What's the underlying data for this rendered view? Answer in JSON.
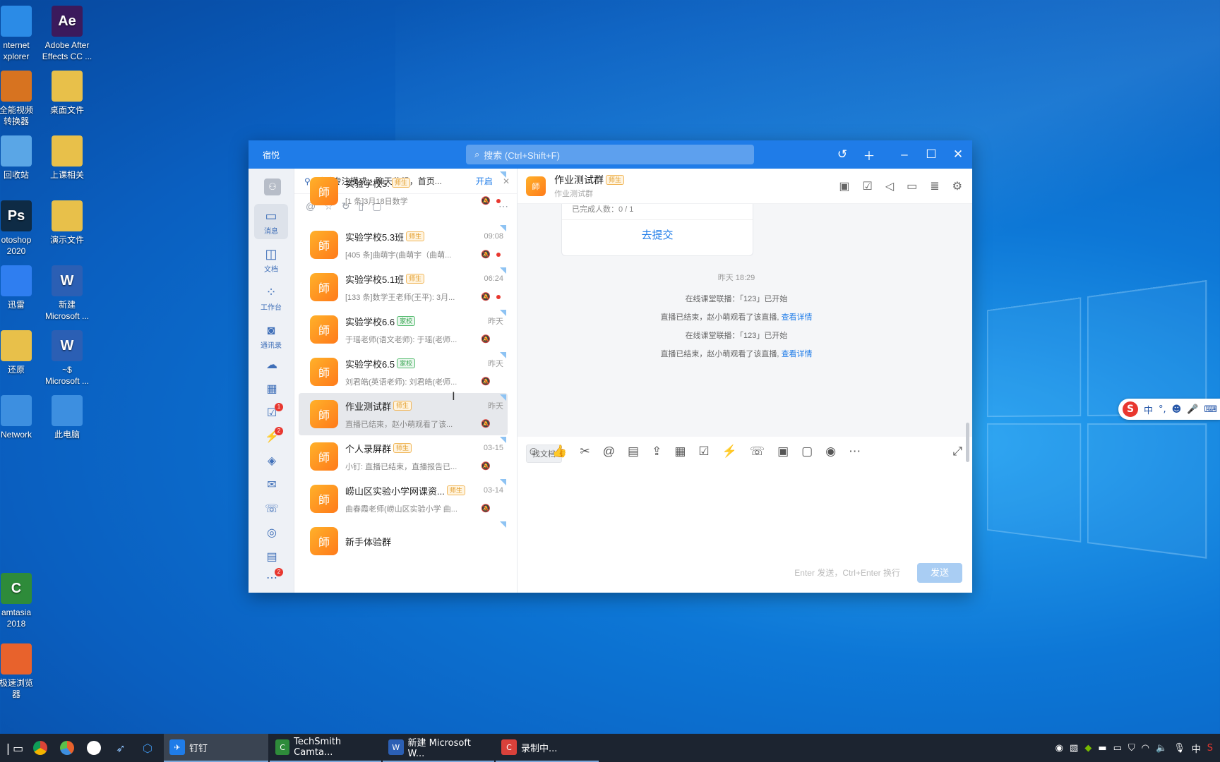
{
  "desktop": {
    "icons": [
      {
        "label1": "nternet",
        "label2": "xplorer",
        "icon": "ie-icon",
        "color": "#2b8be6"
      },
      {
        "label1": "Adobe After",
        "label2": "Effects CC ...",
        "icon": "after-effects-icon",
        "glyph": "Ae",
        "color": "#3b1a5c"
      },
      {
        "label1": "全能视频",
        "label2": "转换器",
        "icon": "video-converter-icon",
        "color": "#d77320"
      },
      {
        "label1": "桌面文件",
        "label2": "",
        "icon": "folder-icon",
        "color": "#e8c04a"
      },
      {
        "label1": "回收站",
        "label2": "",
        "icon": "recycle-bin-icon",
        "color": "#5aa6e6"
      },
      {
        "label1": "上课相关",
        "label2": "",
        "icon": "folder-icon",
        "color": "#e8c04a"
      },
      {
        "label1": "otoshop",
        "label2": "2020",
        "icon": "photoshop-icon",
        "glyph": "Ps",
        "color": "#0e2b45"
      },
      {
        "label1": "演示文件",
        "label2": "",
        "icon": "folder-icon",
        "color": "#e8c04a"
      },
      {
        "label1": "迅雷",
        "label2": "",
        "icon": "xunlei-icon",
        "color": "#2f7ef0"
      },
      {
        "label1": "新建",
        "label2": "Microsoft ...",
        "icon": "word-icon",
        "glyph": "W",
        "color": "#2b5fb4"
      },
      {
        "label1": "还原",
        "label2": "",
        "icon": "folder-icon",
        "color": "#e8c04a"
      },
      {
        "label1": "~$",
        "label2": "Microsoft ...",
        "icon": "word-icon",
        "glyph": "W",
        "color": "#2b5fb4"
      },
      {
        "label1": "Network",
        "label2": "",
        "icon": "network-icon",
        "color": "#3d8fe0"
      },
      {
        "label1": "此电脑",
        "label2": "",
        "icon": "computer-icon",
        "color": "#3d8fe0"
      },
      {
        "label1": "amtasia",
        "label2": "2018",
        "icon": "camtasia-icon",
        "glyph": "C",
        "color": "#2e8b3a"
      },
      {
        "label1": "极速浏览",
        "label2": "器",
        "icon": "browser-icon",
        "color": "#e8622c"
      }
    ]
  },
  "app": {
    "username": "宿悦",
    "search_placeholder": "搜索 (Ctrl+Shift+F)",
    "nav": {
      "messages": "消息",
      "docs": "文档",
      "workbench": "工作台",
      "contacts": "通讯录",
      "badge_todo": "1",
      "badge_ding": "2",
      "badge_more": "2"
    },
    "banner": {
      "text": "试试专注模式，聊天分组，首页...",
      "open": "开启"
    },
    "conversations": [
      {
        "name": "实验学校5.",
        "tag": "师生",
        "tag_style": "orange",
        "time": "",
        "preview": "[1 条]3月18日数学",
        "dot": true
      },
      {
        "name": "实验学校5.3班",
        "tag": "师生",
        "tag_style": "orange",
        "time": "09:08",
        "preview": "[405 条]曲萌宇(曲萌宇（曲萌...",
        "dot": true
      },
      {
        "name": "实验学校5.1班",
        "tag": "师生",
        "tag_style": "orange",
        "time": "06:24",
        "preview": "[133 条]数学王老师(王平): 3月...",
        "dot": true
      },
      {
        "name": "实验学校6.6",
        "tag": "家校",
        "tag_style": "green",
        "time": "昨天",
        "preview": "于瑶老师(语文老师): 于瑶(老师...",
        "dot": false
      },
      {
        "name": "实验学校6.5",
        "tag": "家校",
        "tag_style": "green",
        "time": "昨天",
        "preview": "刘君皓(英语老师): 刘君皓(老师...",
        "dot": false
      },
      {
        "name": "作业测试群",
        "tag": "师生",
        "tag_style": "orange",
        "time": "昨天",
        "preview": "直播已结束，赵小萌观看了该...",
        "dot": false
      },
      {
        "name": "个人录屏群",
        "tag": "师生",
        "tag_style": "orange",
        "time": "03-15",
        "preview": "小钉: 直播已结束，直播报告已...",
        "dot": false
      },
      {
        "name": "崂山区实验小学网课资...",
        "tag": "师生",
        "tag_style": "orange",
        "time": "03-14",
        "preview": "曲春霞老师(崂山区实验小学 曲...",
        "dot": false
      },
      {
        "name": "新手体验群",
        "tag": "",
        "tag_style": "",
        "time": "",
        "preview": "",
        "dot": false
      }
    ],
    "chat": {
      "title": "作业测试群",
      "tag": "师生",
      "subtitle": "作业测试群",
      "card_done": "已完成人数：0 / 1",
      "card_action": "去提交",
      "timestamp": "昨天 18:29",
      "sys1": "在线课堂联播：「123」已开始",
      "sys2": "直播已结束，赵小萌观看了该直播,",
      "sys2_link": "查看详情",
      "sys3": "在线课堂联播：「123」已开始",
      "sys4": "直播已结束，赵小萌观看了该直播,",
      "sys4_link": "查看详情",
      "find_doc": "找文档",
      "hint": "Enter 发送，Ctrl+Enter 换行",
      "send": "发送"
    }
  },
  "ime": {
    "lang": "中",
    "punct": "°,"
  },
  "taskbar": {
    "apps": [
      {
        "label": "钉钉",
        "color": "#1f7ce8",
        "glyph": "✈"
      },
      {
        "label": "TechSmith Camta...",
        "color": "#2e8b3a",
        "glyph": "C"
      },
      {
        "label": "新建 Microsoft W...",
        "color": "#2b5fb4",
        "glyph": "W"
      },
      {
        "label": "录制中...",
        "color": "#d9413b",
        "glyph": "C"
      }
    ],
    "tray_lang": "中"
  }
}
